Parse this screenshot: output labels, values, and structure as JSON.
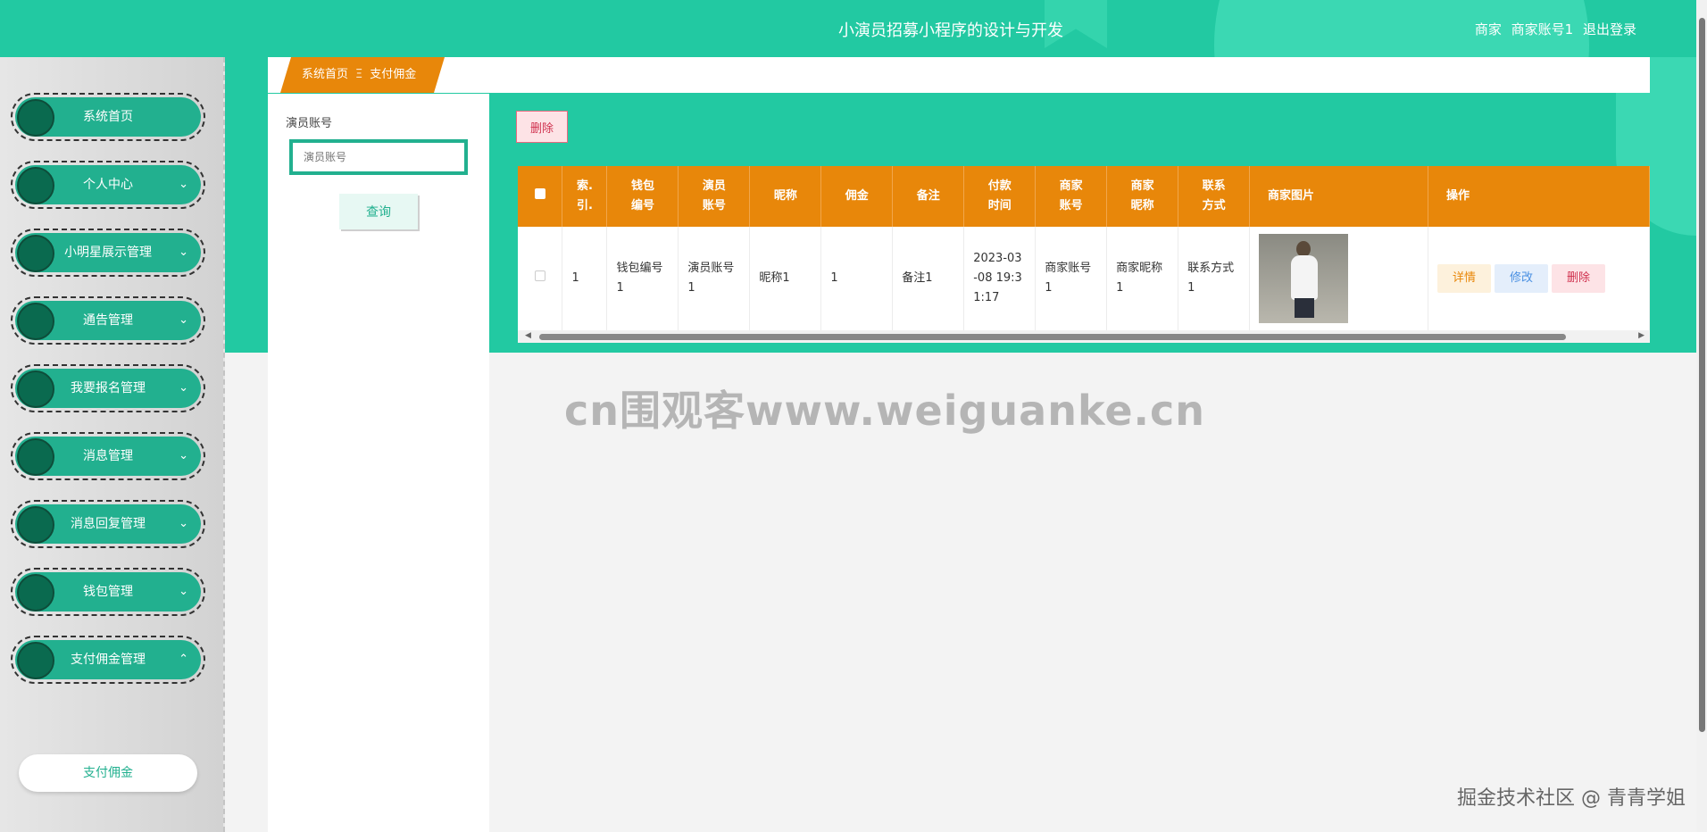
{
  "header": {
    "title": "小演员招募小程序的设计与开发",
    "role": "商家",
    "username": "商家账号1",
    "logout": "退出登录"
  },
  "sidebar": {
    "items": [
      {
        "label": "系统首页",
        "chevron": ""
      },
      {
        "label": "个人中心",
        "chevron": "⌄"
      },
      {
        "label": "小明星展示管理",
        "chevron": "⌄"
      },
      {
        "label": "通告管理",
        "chevron": "⌄"
      },
      {
        "label": "我要报名管理",
        "chevron": "⌄"
      },
      {
        "label": "消息管理",
        "chevron": "⌄"
      },
      {
        "label": "消息回复管理",
        "chevron": "⌄"
      },
      {
        "label": "钱包管理",
        "chevron": "⌄"
      },
      {
        "label": "支付佣金管理",
        "chevron": "⌃"
      }
    ],
    "submenu": "支付佣金"
  },
  "breadcrumb": {
    "home": "系统首页",
    "sep": "Ξ",
    "current": "支付佣金"
  },
  "search": {
    "label": "演员账号",
    "placeholder": "演员账号",
    "button": "查询"
  },
  "toolbar": {
    "delete": "删除"
  },
  "table": {
    "headers": [
      "索引",
      "钱包编号",
      "演员账号",
      "昵称",
      "佣金",
      "备注",
      "付款时间",
      "商家账号",
      "商家昵称",
      "联系方式",
      "商家图片",
      "操作"
    ],
    "header_lines": [
      [
        "索.",
        "引."
      ],
      [
        "钱包",
        "编号"
      ],
      [
        "演员",
        "账号"
      ],
      [
        "昵称"
      ],
      [
        "佣金"
      ],
      [
        "备注"
      ],
      [
        "付款",
        "时间"
      ],
      [
        "商家",
        "账号"
      ],
      [
        "商家",
        "昵称"
      ],
      [
        "联系",
        "方式"
      ],
      [
        "商家图片"
      ],
      [
        "操作"
      ]
    ],
    "rows": [
      {
        "index": "1",
        "wallet_no": "钱包编号1",
        "actor_account": "演员账号1",
        "nickname": "昵称1",
        "commission": "1",
        "remark": "备注1",
        "pay_time": "2023-03-08 19:31:17",
        "merchant_account": "商家账号1",
        "merchant_nickname": "商家昵称1",
        "contact": "联系方式1",
        "actions": {
          "detail": "详情",
          "edit": "修改",
          "delete": "删除"
        }
      }
    ]
  },
  "watermark": "cn围观客www.weiguanke.cn",
  "credit": "掘金技术社区 @ 青青学姐"
}
